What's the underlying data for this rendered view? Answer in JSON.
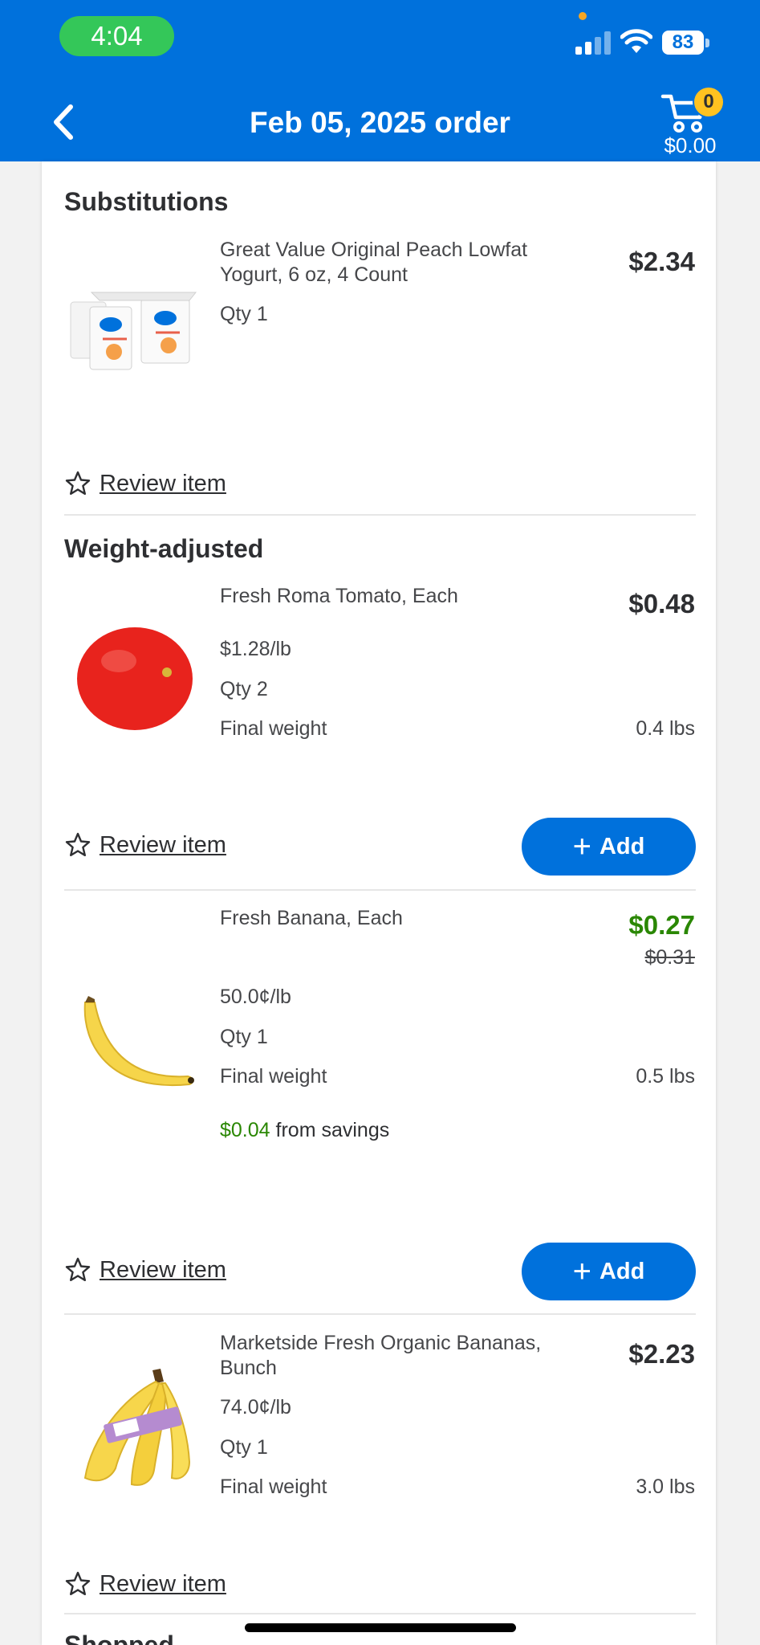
{
  "status_bar": {
    "time": "4:04",
    "battery": "83"
  },
  "header": {
    "title": "Feb 05, 2025 order",
    "cart_count": "0",
    "cart_total": "$0.00"
  },
  "sections": {
    "substitutions": "Substitutions",
    "weight_adjusted": "Weight-adjusted",
    "shopped": "Shopped"
  },
  "items": [
    {
      "name": "Great Value Original Peach Lowfat Yogurt, 6 oz, 4 Count",
      "price": "$2.34",
      "qty": "Qty 1"
    },
    {
      "name": "Fresh Roma Tomato, Each",
      "price": "$0.48",
      "unit_price": "$1.28/lb",
      "qty": "Qty 2",
      "final_weight_label": "Final weight",
      "final_weight": "0.4 lbs"
    },
    {
      "name": "Fresh Banana, Each",
      "price": "$0.27",
      "old_price": "$0.31",
      "unit_price": "50.0¢/lb",
      "qty": "Qty 1",
      "final_weight_label": "Final weight",
      "final_weight": "0.5 lbs",
      "savings_amount": "$0.04",
      "savings_text": "from savings"
    },
    {
      "name": "Marketside Fresh Organic Bananas, Bunch",
      "price": "$2.23",
      "unit_price": "74.0¢/lb",
      "qty": "Qty 1",
      "final_weight_label": "Final weight",
      "final_weight": "3.0 lbs"
    }
  ],
  "actions": {
    "review_item": "Review item",
    "add": "Add"
  },
  "colors": {
    "brand_blue": "#0071dc",
    "savings_green": "#2a8703",
    "badge_yellow": "#ffc220"
  },
  "icons": [
    "back-chevron-icon",
    "cart-icon",
    "star-outline-icon",
    "plus-icon",
    "signal-icon",
    "wifi-icon",
    "battery-icon"
  ]
}
